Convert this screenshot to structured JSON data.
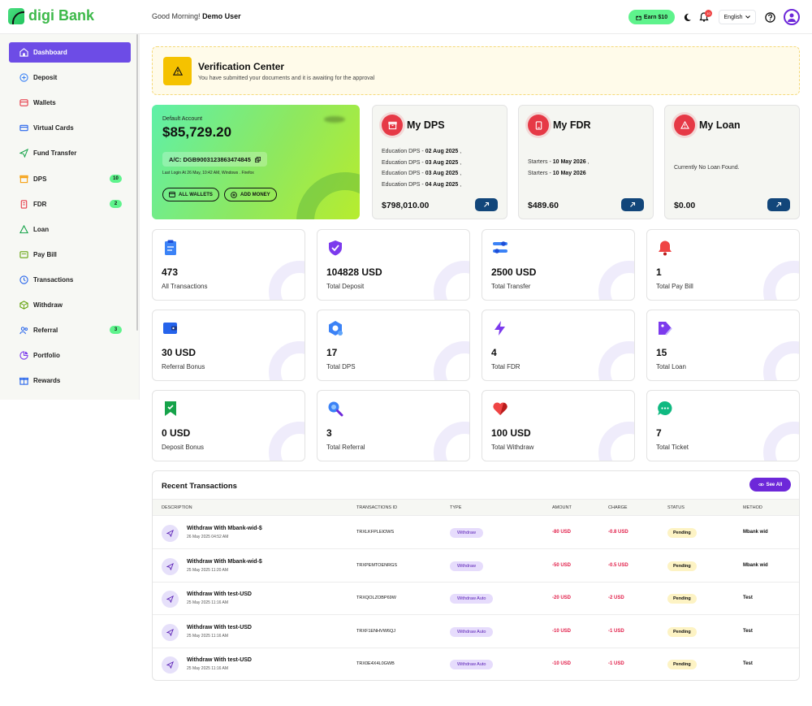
{
  "header": {
    "logo": "digi Bank",
    "greeting": "Good Morning!",
    "user": "Demo User",
    "earn": "Earn $10",
    "notif_count": "10",
    "language": "English"
  },
  "sidebar": {
    "items": [
      {
        "label": "Dashboard",
        "icon": "dashboard-icon",
        "badge": ""
      },
      {
        "label": "Deposit",
        "icon": "deposit-icon",
        "badge": ""
      },
      {
        "label": "Wallets",
        "icon": "wallet-icon",
        "badge": ""
      },
      {
        "label": "Virtual Cards",
        "icon": "card-icon",
        "badge": ""
      },
      {
        "label": "Fund Transfer",
        "icon": "send-icon",
        "badge": ""
      },
      {
        "label": "DPS",
        "icon": "dps-icon",
        "badge": "10"
      },
      {
        "label": "FDR",
        "icon": "fdr-icon",
        "badge": "2"
      },
      {
        "label": "Loan",
        "icon": "loan-icon",
        "badge": ""
      },
      {
        "label": "Pay Bill",
        "icon": "bill-icon",
        "badge": ""
      },
      {
        "label": "Transactions",
        "icon": "transactions-icon",
        "badge": ""
      },
      {
        "label": "Withdraw",
        "icon": "withdraw-icon",
        "badge": ""
      },
      {
        "label": "Referral",
        "icon": "referral-icon",
        "badge": "3"
      },
      {
        "label": "Portfolio",
        "icon": "portfolio-icon",
        "badge": ""
      },
      {
        "label": "Rewards",
        "icon": "rewards-icon",
        "badge": ""
      }
    ]
  },
  "verification": {
    "title": "Verification Center",
    "message": "You have submitted your documents and it is awaiting for the approval"
  },
  "account": {
    "label": "Default Account",
    "balance": "$85,729.20",
    "account_no": "A/C: DGB9003123863474845",
    "last_login": "Last Login At 26 May, 10:42 AM, Windows . Firefox",
    "all_wallets": "ALL WALLETS",
    "add_money": "ADD MONEY"
  },
  "dps": {
    "title": "My DPS",
    "lines": [
      {
        "name": "Education DPS - ",
        "date": "02 Aug 2025"
      },
      {
        "name": "Education DPS - ",
        "date": "03 Aug 2025"
      },
      {
        "name": "Education DPS - ",
        "date": "03 Aug 2025"
      },
      {
        "name": "Education DPS - ",
        "date": "04 Aug 2025"
      }
    ],
    "total": "$798,010.00"
  },
  "fdr": {
    "title": "My FDR",
    "lines": [
      {
        "name": "Starters - ",
        "date": "10 May 2026"
      },
      {
        "name": "Starters - ",
        "date": "10 May 2026"
      }
    ],
    "total": "$489.60"
  },
  "loan": {
    "title": "My Loan",
    "message": "Currently No Loan Found.",
    "total": "$0.00"
  },
  "stats": [
    {
      "value": "473",
      "label": "All Transactions",
      "icon": "clipboard-icon"
    },
    {
      "value": "104828 USD",
      "label": "Total Deposit",
      "icon": "shield-check-icon"
    },
    {
      "value": "2500 USD",
      "label": "Total Transfer",
      "icon": "transfer-icon"
    },
    {
      "value": "1",
      "label": "Total Pay Bill",
      "icon": "bell-icon"
    },
    {
      "value": "30 USD",
      "label": "Referral Bonus",
      "icon": "wallet-icon"
    },
    {
      "value": "17",
      "label": "Total DPS",
      "icon": "hexagon-icon"
    },
    {
      "value": "4",
      "label": "Total FDR",
      "icon": "lightning-icon"
    },
    {
      "value": "15",
      "label": "Total Loan",
      "icon": "tag-icon"
    },
    {
      "value": "0 USD",
      "label": "Deposit Bonus",
      "icon": "bookmark-icon"
    },
    {
      "value": "3",
      "label": "Total Referral",
      "icon": "search-icon"
    },
    {
      "value": "100 USD",
      "label": "Total Withdraw",
      "icon": "heart-icon"
    },
    {
      "value": "7",
      "label": "Total Ticket",
      "icon": "chat-icon"
    }
  ],
  "transactions": {
    "title": "Recent Transactions",
    "see_all": "See All",
    "columns": [
      "DESCRIPTION",
      "TRANSACTIONS ID",
      "TYPE",
      "AMOUNT",
      "CHARGE",
      "STATUS",
      "METHOD"
    ],
    "rows": [
      {
        "desc": "Withdraw With Mbank-wid-$",
        "date": "26 May 2025 04:52 AM",
        "id": "TRXLKFPLEIOWS",
        "type": "Withdraw",
        "amount": "-80 USD",
        "charge": "-0.8 USD",
        "status": "Pending",
        "method": "Mbank wid"
      },
      {
        "desc": "Withdraw With Mbank-wid-$",
        "date": "25 May 2025 11:20 AM",
        "id": "TRXPEMTOENRGS",
        "type": "Withdraw",
        "amount": "-50 USD",
        "charge": "-0.5 USD",
        "status": "Pending",
        "method": "Mbank wid"
      },
      {
        "desc": "Withdraw With test-USD",
        "date": "25 May 2025 11:16 AM",
        "id": "TRXQOLZOBP69W",
        "type": "Withdraw Auto",
        "amount": "-20 USD",
        "charge": "-2 USD",
        "status": "Pending",
        "method": "Test"
      },
      {
        "desc": "Withdraw With test-USD",
        "date": "25 May 2025 11:16 AM",
        "id": "TRXF1ENHVW6QJ",
        "type": "Withdraw Auto",
        "amount": "-10 USD",
        "charge": "-1 USD",
        "status": "Pending",
        "method": "Test"
      },
      {
        "desc": "Withdraw With test-USD",
        "date": "25 May 2025 11:16 AM",
        "id": "TRX0E4X4L0GWB",
        "type": "Withdraw Auto",
        "amount": "-10 USD",
        "charge": "-1 USD",
        "status": "Pending",
        "method": "Test"
      }
    ]
  }
}
